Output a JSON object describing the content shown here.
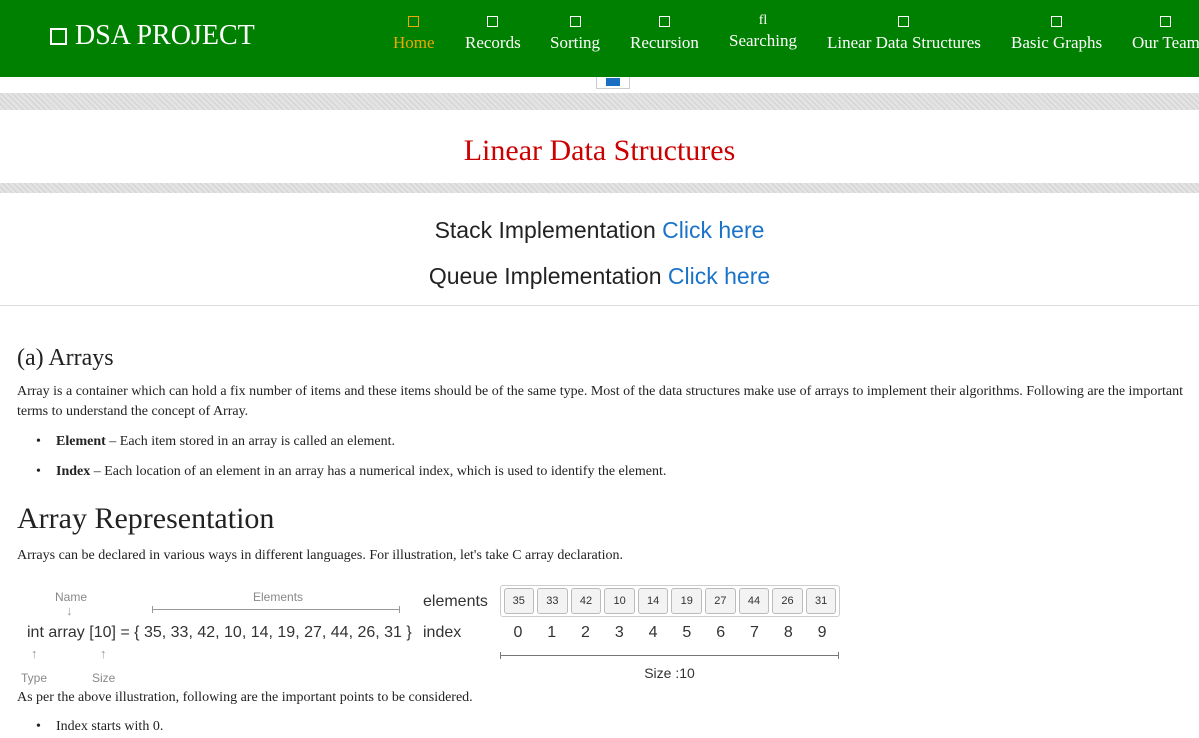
{
  "header": {
    "brand": "DSA PROJECT",
    "nav": [
      {
        "label": "Home",
        "active": true
      },
      {
        "label": "Records"
      },
      {
        "label": "Sorting"
      },
      {
        "label": "Recursion"
      },
      {
        "label": "Searching",
        "glyph": "fl"
      },
      {
        "label": "Linear Data Structures"
      },
      {
        "label": "Basic Graphs"
      },
      {
        "label": "Our Team"
      }
    ],
    "toggle_icon": "menu-toggle-icon",
    "colors": {
      "bar": "#008000",
      "active": "#f0a500"
    }
  },
  "page": {
    "title": "Linear Data Structures",
    "title_color": "#cc0000",
    "links": [
      {
        "text": "Stack Implementation",
        "link": "Click here"
      },
      {
        "text": "Queue Implementation",
        "link": "Click here"
      }
    ],
    "link_color": "#1a73c9"
  },
  "arrays": {
    "heading": "(a) Arrays",
    "intro": "Array is a container which can hold a fix number of items and these items should be of the same type. Most of the data structures make use of arrays to implement their algorithms. Following are the important terms to understand the concept of Array.",
    "terms": [
      {
        "term": "Element",
        "desc": "– Each item stored in an array is called an element."
      },
      {
        "term": "Index",
        "desc": "– Each location of an element in an array has a numerical index, which is used to identify the element."
      }
    ]
  },
  "representation": {
    "heading": "Array Representation",
    "intro": "Arrays can be declared in various ways in different languages. For illustration, let's take C array declaration.",
    "after": "As per the above illustration, following are the important points to be considered.",
    "points": [
      "Index starts with 0."
    ],
    "illustration": {
      "name_label": "Name",
      "elements_label": "Elements",
      "type_label": "Type",
      "size_label": "Size",
      "declaration": "int array [10] = { 35, 33, 42, 10, 14, 19, 27, 44, 26, 31 }",
      "elements_word": "elements",
      "index_word": "index",
      "values": [
        "35",
        "33",
        "42",
        "10",
        "14",
        "19",
        "27",
        "44",
        "26",
        "31"
      ],
      "indices": [
        "0",
        "1",
        "2",
        "3",
        "4",
        "5",
        "6",
        "7",
        "8",
        "9"
      ],
      "size_text": "Size :10"
    }
  }
}
